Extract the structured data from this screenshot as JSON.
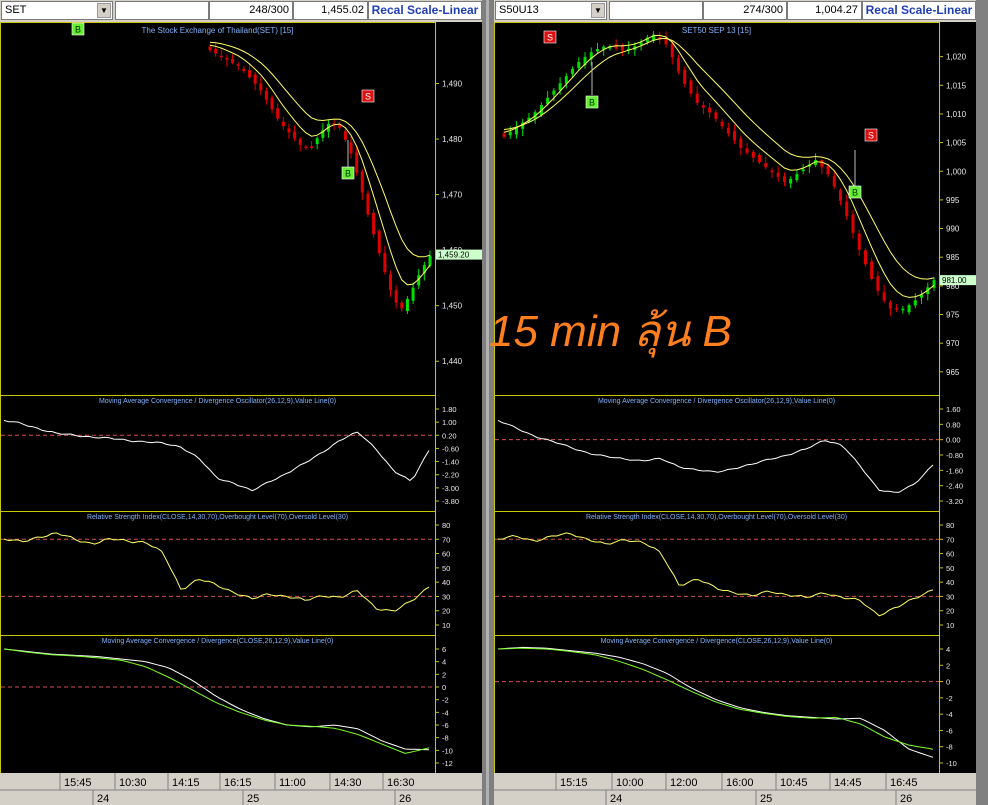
{
  "left": {
    "symbol": "SET",
    "count": "248/300",
    "last": "1,455.02",
    "recal_label": "Recal Scale-Linear",
    "price_title": "The Stock Exchange of Thailand(SET) [15]",
    "price_ticks": [
      "1,490",
      "1,480",
      "1,470",
      "1,460",
      "1,450",
      "1,440"
    ],
    "current_price": "1,459.20",
    "macd_title": "Moving Average Convergence / Divergence Oscillator(26,12,9),Value Line(0)",
    "macd_ticks": [
      "1.80",
      "1.00",
      "0.20",
      "-0.60",
      "-1.40",
      "-2.20",
      "-3.00",
      "-3.80"
    ],
    "rsi_title": "Relative Strength Index(CLOSE,14,30,70),Overbought Level(70),Oversold Level(30)",
    "rsi_ticks": [
      "80",
      "70",
      "60",
      "50",
      "40",
      "30",
      "20",
      "10"
    ],
    "macd2_title": "Moving Average Convergence / Divergence(CLOSE,26,12,9),Value Line(0)",
    "macd2_ticks": [
      "6",
      "4",
      "2",
      "0",
      "-2",
      "-4",
      "-6",
      "-8",
      "-10",
      "-12"
    ],
    "time_labels": [
      "15:45",
      "10:30",
      "14:15",
      "16:15",
      "11:00",
      "14:30",
      "16:30"
    ],
    "date_labels": [
      "24",
      "25",
      "26"
    ],
    "markers": [
      {
        "label": "B",
        "kind": "buy"
      },
      {
        "label": "S",
        "kind": "sell"
      },
      {
        "label": "B",
        "kind": "buy"
      }
    ]
  },
  "right": {
    "symbol": "S50U13",
    "count": "274/300",
    "last": "1,004.27",
    "recal_label": "Recal Scale-Linear",
    "price_title": "SET50 SEP 13  [15]",
    "price_ticks": [
      "1,020",
      "1,015",
      "1,010",
      "1,005",
      "1,000",
      "995",
      "990",
      "985",
      "980",
      "975",
      "970",
      "965"
    ],
    "current_price": "981.00",
    "macd_title": "Moving Average Convergence / Divergence Oscillator(26,12,9),Value Line(0)",
    "macd_ticks": [
      "1.60",
      "0.80",
      "0.00",
      "-0.80",
      "-1.60",
      "-2.40",
      "-3.20"
    ],
    "rsi_title": "Relative Strength Index(CLOSE,14,30,70),Overbought Level(70),Oversold Level(30)",
    "rsi_ticks": [
      "80",
      "70",
      "60",
      "50",
      "40",
      "30",
      "20",
      "10"
    ],
    "macd2_title": "Moving Average Convergence / Divergence(CLOSE,26,12,9),Value Line(0)",
    "macd2_ticks": [
      "4",
      "2",
      "0",
      "-2",
      "-4",
      "-6",
      "-8",
      "-10"
    ],
    "time_labels": [
      "15:15",
      "10:00",
      "12:00",
      "16:00",
      "10:45",
      "14:45",
      "16:45"
    ],
    "date_labels": [
      "24",
      "25",
      "26"
    ],
    "markers": [
      {
        "label": "S",
        "kind": "sell"
      },
      {
        "label": "B",
        "kind": "buy"
      },
      {
        "label": "S",
        "kind": "sell"
      },
      {
        "label": "B",
        "kind": "buy"
      }
    ]
  },
  "overlay_text": "15 min ลุ้น B",
  "colors": {
    "up": "#00e000",
    "down": "#e00000",
    "ma": "#ffff66",
    "osc": "#ffffff",
    "buy": "#66ee33",
    "sell": "#dd1111",
    "panel_border": "#c8c800",
    "price_tag": "#ccffcc",
    "overlay": "#ff7f1e"
  },
  "chart_data": [
    {
      "type": "line",
      "series": [
        {
          "values": [
            1496,
            1495,
            1494,
            1493,
            1491,
            1489,
            1486,
            1483,
            1481,
            1479,
            1478,
            1481,
            1483,
            1482,
            1478,
            1472,
            1465,
            1459,
            1453,
            1449,
            1452,
            1456,
            1459
          ]
        }
      ],
      "ylim": [
        1435,
        1500
      ]
    },
    {
      "type": "line",
      "series": [
        {
          "values": [
            1006,
            1008,
            1010,
            1013,
            1016,
            1019,
            1021,
            1022,
            1021,
            1022,
            1024,
            1022,
            1016,
            1012,
            1010,
            1007,
            1004,
            1002,
            1000,
            998,
            1000,
            1002,
            999,
            993,
            986,
            980,
            976,
            976,
            978,
            981
          ]
        }
      ],
      "ylim": [
        962,
        1025
      ]
    }
  ]
}
